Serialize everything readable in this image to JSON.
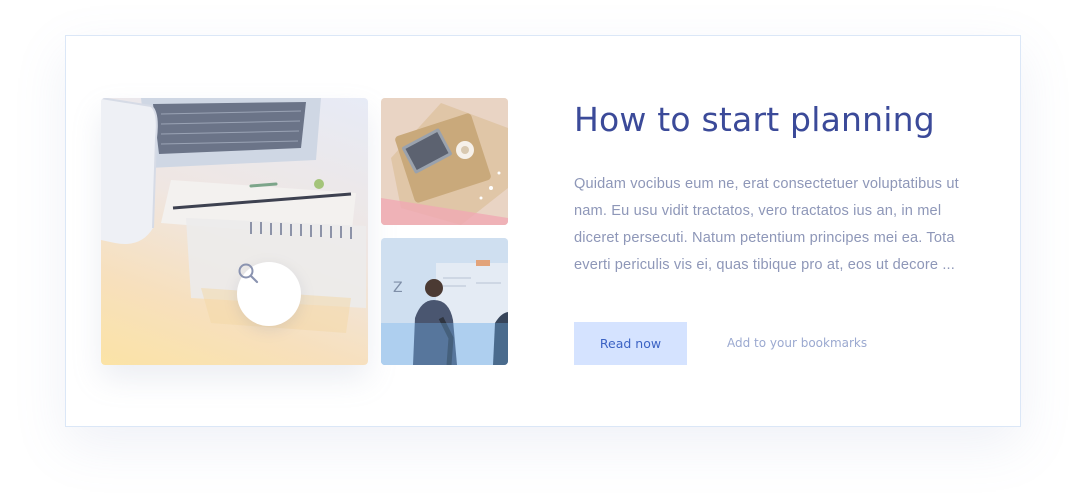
{
  "article": {
    "title": "How to start planning",
    "description": "Quidam vocibus eum ne, erat consectetuer voluptatibus ut nam. Eu usu vidit tractatos, vero tractatos ius an, in mel diceret persecuti. Natum petentium principes mei ea. Tota everti periculis vis ei, quas tibique pro at, eos ut decore ...",
    "read_button_label": "Read now",
    "bookmark_link_label": "Add to your bookmarks"
  },
  "gallery": {
    "main_image": "desk-laptop-notebook-photo",
    "top_image": "laptop-on-tray-photo",
    "bottom_image": "people-at-whiteboard-photo",
    "zoom_icon": "search-icon"
  },
  "colors": {
    "title": "#3b4a99",
    "body_text": "#8e97b8",
    "button_bg": "#d5e3ff",
    "button_text": "#3c63c4",
    "link_text": "#9ba9d0",
    "card_border": "#dbe7f7"
  }
}
